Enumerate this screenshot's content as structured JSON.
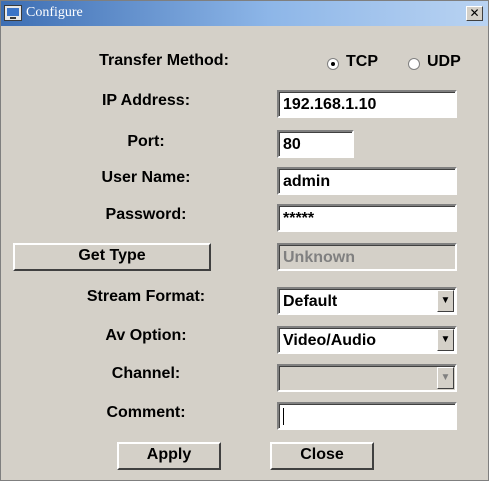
{
  "window": {
    "title": "Configure",
    "close_glyph": "✕"
  },
  "transfer": {
    "label": "Transfer Method:",
    "options": [
      {
        "label": "TCP",
        "selected": true
      },
      {
        "label": "UDP",
        "selected": false
      }
    ]
  },
  "ip": {
    "label": "IP Address:",
    "value": "192.168.1.10"
  },
  "port": {
    "label": "Port:",
    "value": "80"
  },
  "username": {
    "label": "User Name:",
    "value": "admin"
  },
  "password": {
    "label": "Password:",
    "value": "*****"
  },
  "get_type": {
    "button_label": "Get Type",
    "value": "Unknown"
  },
  "stream_format": {
    "label": "Stream Format:",
    "value": "Default"
  },
  "av_option": {
    "label": "Av Option:",
    "value": "Video/Audio"
  },
  "channel": {
    "label": "Channel:",
    "value": ""
  },
  "comment": {
    "label": "Comment:",
    "value": ""
  },
  "buttons": {
    "apply": "Apply",
    "close": "Close"
  },
  "icons": {
    "app": "monitor-icon",
    "dropdown": "chevron-down-icon",
    "close": "close-icon"
  },
  "colors": {
    "titlebar_start": "#3d6eb3",
    "titlebar_end": "#b9d3f2",
    "dialog_bg": "#d4d0c8"
  }
}
